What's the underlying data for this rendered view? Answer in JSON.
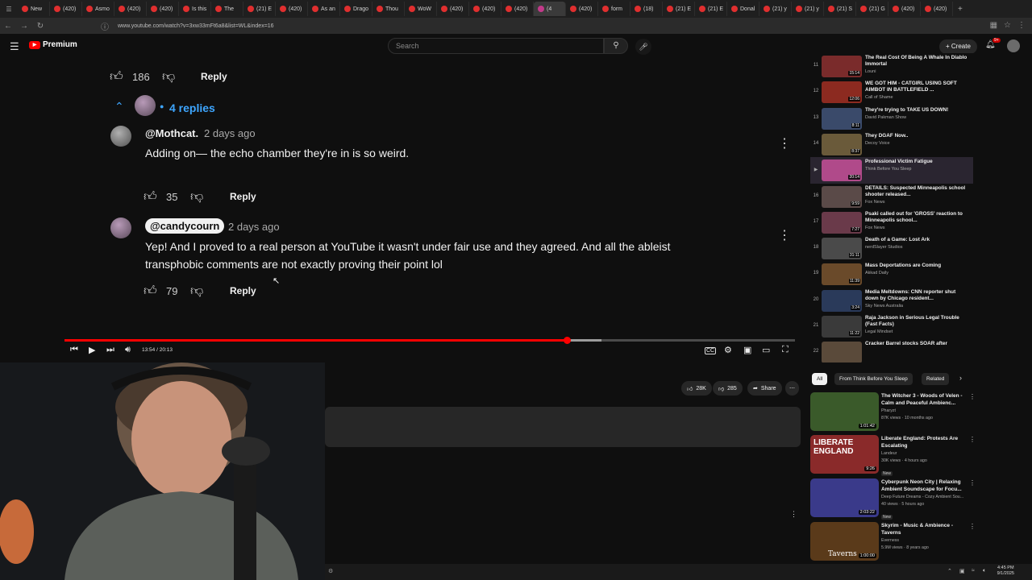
{
  "browser": {
    "tabs": [
      "New",
      "(420)",
      "Asmo",
      "(420)",
      "(420)",
      "Is this",
      "The",
      "(21) E",
      "(420)",
      "As an",
      "Drago",
      "Thou",
      "WoW",
      "(420)",
      "(420)",
      "(420)",
      "(4",
      "(420)",
      "form",
      "(18)",
      "(21) E",
      "(21) E",
      "Donal",
      "(21) y",
      "(21) y",
      "(21) S",
      "(21) G",
      "(420)",
      "(420)"
    ],
    "active_tab_index": 16,
    "url": "www.youtube.com/watch?v=3xw33mFt6a8&list=WL&index=16"
  },
  "masthead": {
    "logo_text": "Premium",
    "search_placeholder": "Search",
    "create_label": "Create",
    "notif_count": "9+"
  },
  "comments": {
    "parent_likes": "186",
    "reply_label": "Reply",
    "replies_count_label": "4 replies",
    "replies": [
      {
        "author": "@Mothcat.",
        "time": "2 days ago",
        "text": "Adding on— the echo chamber they're in is so weird.",
        "likes": "35"
      },
      {
        "author": "@candycourn",
        "time": "2 days ago",
        "text": "Yep! And I proved to a real person at YouTube it wasn't under fair use and they agreed. And all the ableist transphobic comments are not exactly proving their point lol",
        "likes": "79"
      }
    ]
  },
  "player": {
    "time_current": "13:54",
    "time_total": "20:13",
    "progress": 0.688,
    "buffered": 0.735
  },
  "actions": {
    "likes": "28K",
    "dislikes": "285",
    "share_label": "Share"
  },
  "playlist": [
    {
      "idx": "11",
      "title": "The Real Cost Of Being A Whale In Diablo Immortal",
      "channel": "Louni",
      "dur": "15:14",
      "color": "#7a2b2b"
    },
    {
      "idx": "12",
      "title": "WE GOT HIM - CATGIRL USING SOFT AIMBOT IN BATTLEFIELD ...",
      "channel": "Call of Shame",
      "dur": "12:06",
      "color": "#8c2a20"
    },
    {
      "idx": "13",
      "title": "They're trying to TAKE US DOWN!",
      "channel": "David Pakman Show",
      "dur": "8:11",
      "color": "#3a4a6a"
    },
    {
      "idx": "14",
      "title": "They DGAF Now..",
      "channel": "Decoy Voice",
      "dur": "8:37",
      "color": "#6a5a3a"
    },
    {
      "idx": "▶",
      "title": "Professional Victim Fatigue",
      "channel": "Think Before You Sleep",
      "dur": "20:14",
      "color": "#b04a8a",
      "active": true
    },
    {
      "idx": "16",
      "title": "DETAILS: Suspected Minneapolis school shooter released...",
      "channel": "Fox News",
      "dur": "9:59",
      "color": "#5a4a48"
    },
    {
      "idx": "17",
      "title": "Psaki called out for 'GROSS' reaction to Minneapolis school...",
      "channel": "Fox News",
      "dur": "7:27",
      "color": "#6a3a4a"
    },
    {
      "idx": "18",
      "title": "Death of a Game: Lost Ark",
      "channel": "nerdSlayer Studios",
      "dur": "31:11",
      "color": "#4a4a4a"
    },
    {
      "idx": "19",
      "title": "Mass Deportations are Coming",
      "channel": "Akkad Daily",
      "dur": "11:39",
      "color": "#6a4a2a"
    },
    {
      "idx": "20",
      "title": "Media Meltdowns: CNN reporter shut down by Chicago resident...",
      "channel": "Sky News Australia",
      "dur": "3:24",
      "color": "#2a3a5a"
    },
    {
      "idx": "21",
      "title": "Raja Jackson in Serious Legal Trouble (Fast Facts)",
      "channel": "Legal Mindset",
      "dur": "11:22",
      "color": "#3a3a3a"
    },
    {
      "idx": "22",
      "title": "Cracker Barrel stocks SOAR after",
      "channel": "",
      "dur": "",
      "color": "#5a4a3a"
    }
  ],
  "chips": [
    "All",
    "From Think Before You Sleep",
    "Related"
  ],
  "recommendations": [
    {
      "title": "The Witcher 3 - Woods of Velen - Calm and Peaceful Ambienc...",
      "channel": "Pharyzt",
      "stats": "87K views · 10 months ago",
      "new": "",
      "dur": "1:01:42",
      "color": "#3a5a2a"
    },
    {
      "title": "Liberate England: Protests Are Escalating",
      "channel": "Landeur",
      "stats": "30K views · 4 hours ago",
      "new": "New",
      "dur": "9:26",
      "color": "#8a2a2a"
    },
    {
      "title": "Cyberpunk Neon City | Relaxing Ambient Soundscape for Focu...",
      "channel": "Deep Future Dreams - Cozy Ambient Sou...",
      "stats": "40 views · 5 hours ago",
      "new": "New",
      "dur": "2:03:22",
      "color": "#3a3a8a"
    },
    {
      "title": "Skyrim - Music & Ambience - Taverns",
      "channel": "Everness",
      "stats": "5.9M views · 8 years ago",
      "new": "",
      "dur": "1:00:00",
      "color": "#5a3a1a"
    }
  ],
  "rec_overlay_text": [
    "LIBERATE",
    "ENGLAND",
    "Taverns"
  ],
  "taskbar": {
    "time": "4:45 PM",
    "date": "9/1/2025"
  }
}
